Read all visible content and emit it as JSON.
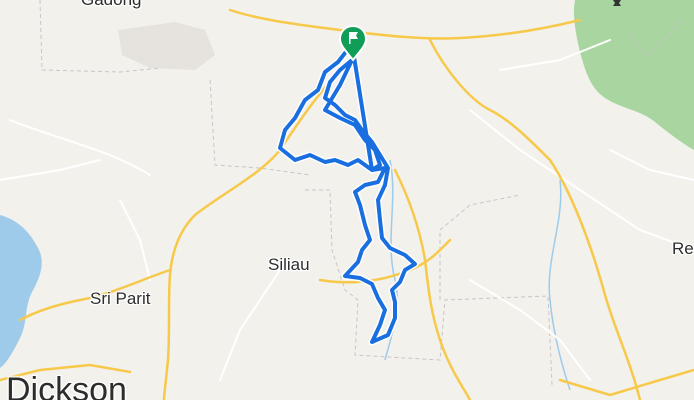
{
  "map": {
    "labels": {
      "gadong": "Gadong",
      "siliau": "Siliau",
      "sri_parit": "Sri Parit",
      "dickson": "Dickson",
      "re": "Re"
    },
    "icons": {
      "start": "flag-pin-icon",
      "peak": "peak-triangle-icon"
    },
    "colors": {
      "route": "#1a6fe0",
      "land": "#f3f1ec",
      "water": "#9ecbea",
      "forest": "#a8d5a0",
      "major_road": "#f7c94a",
      "minor_road": "#ffffff",
      "start_pin": "#0f9d58"
    }
  }
}
